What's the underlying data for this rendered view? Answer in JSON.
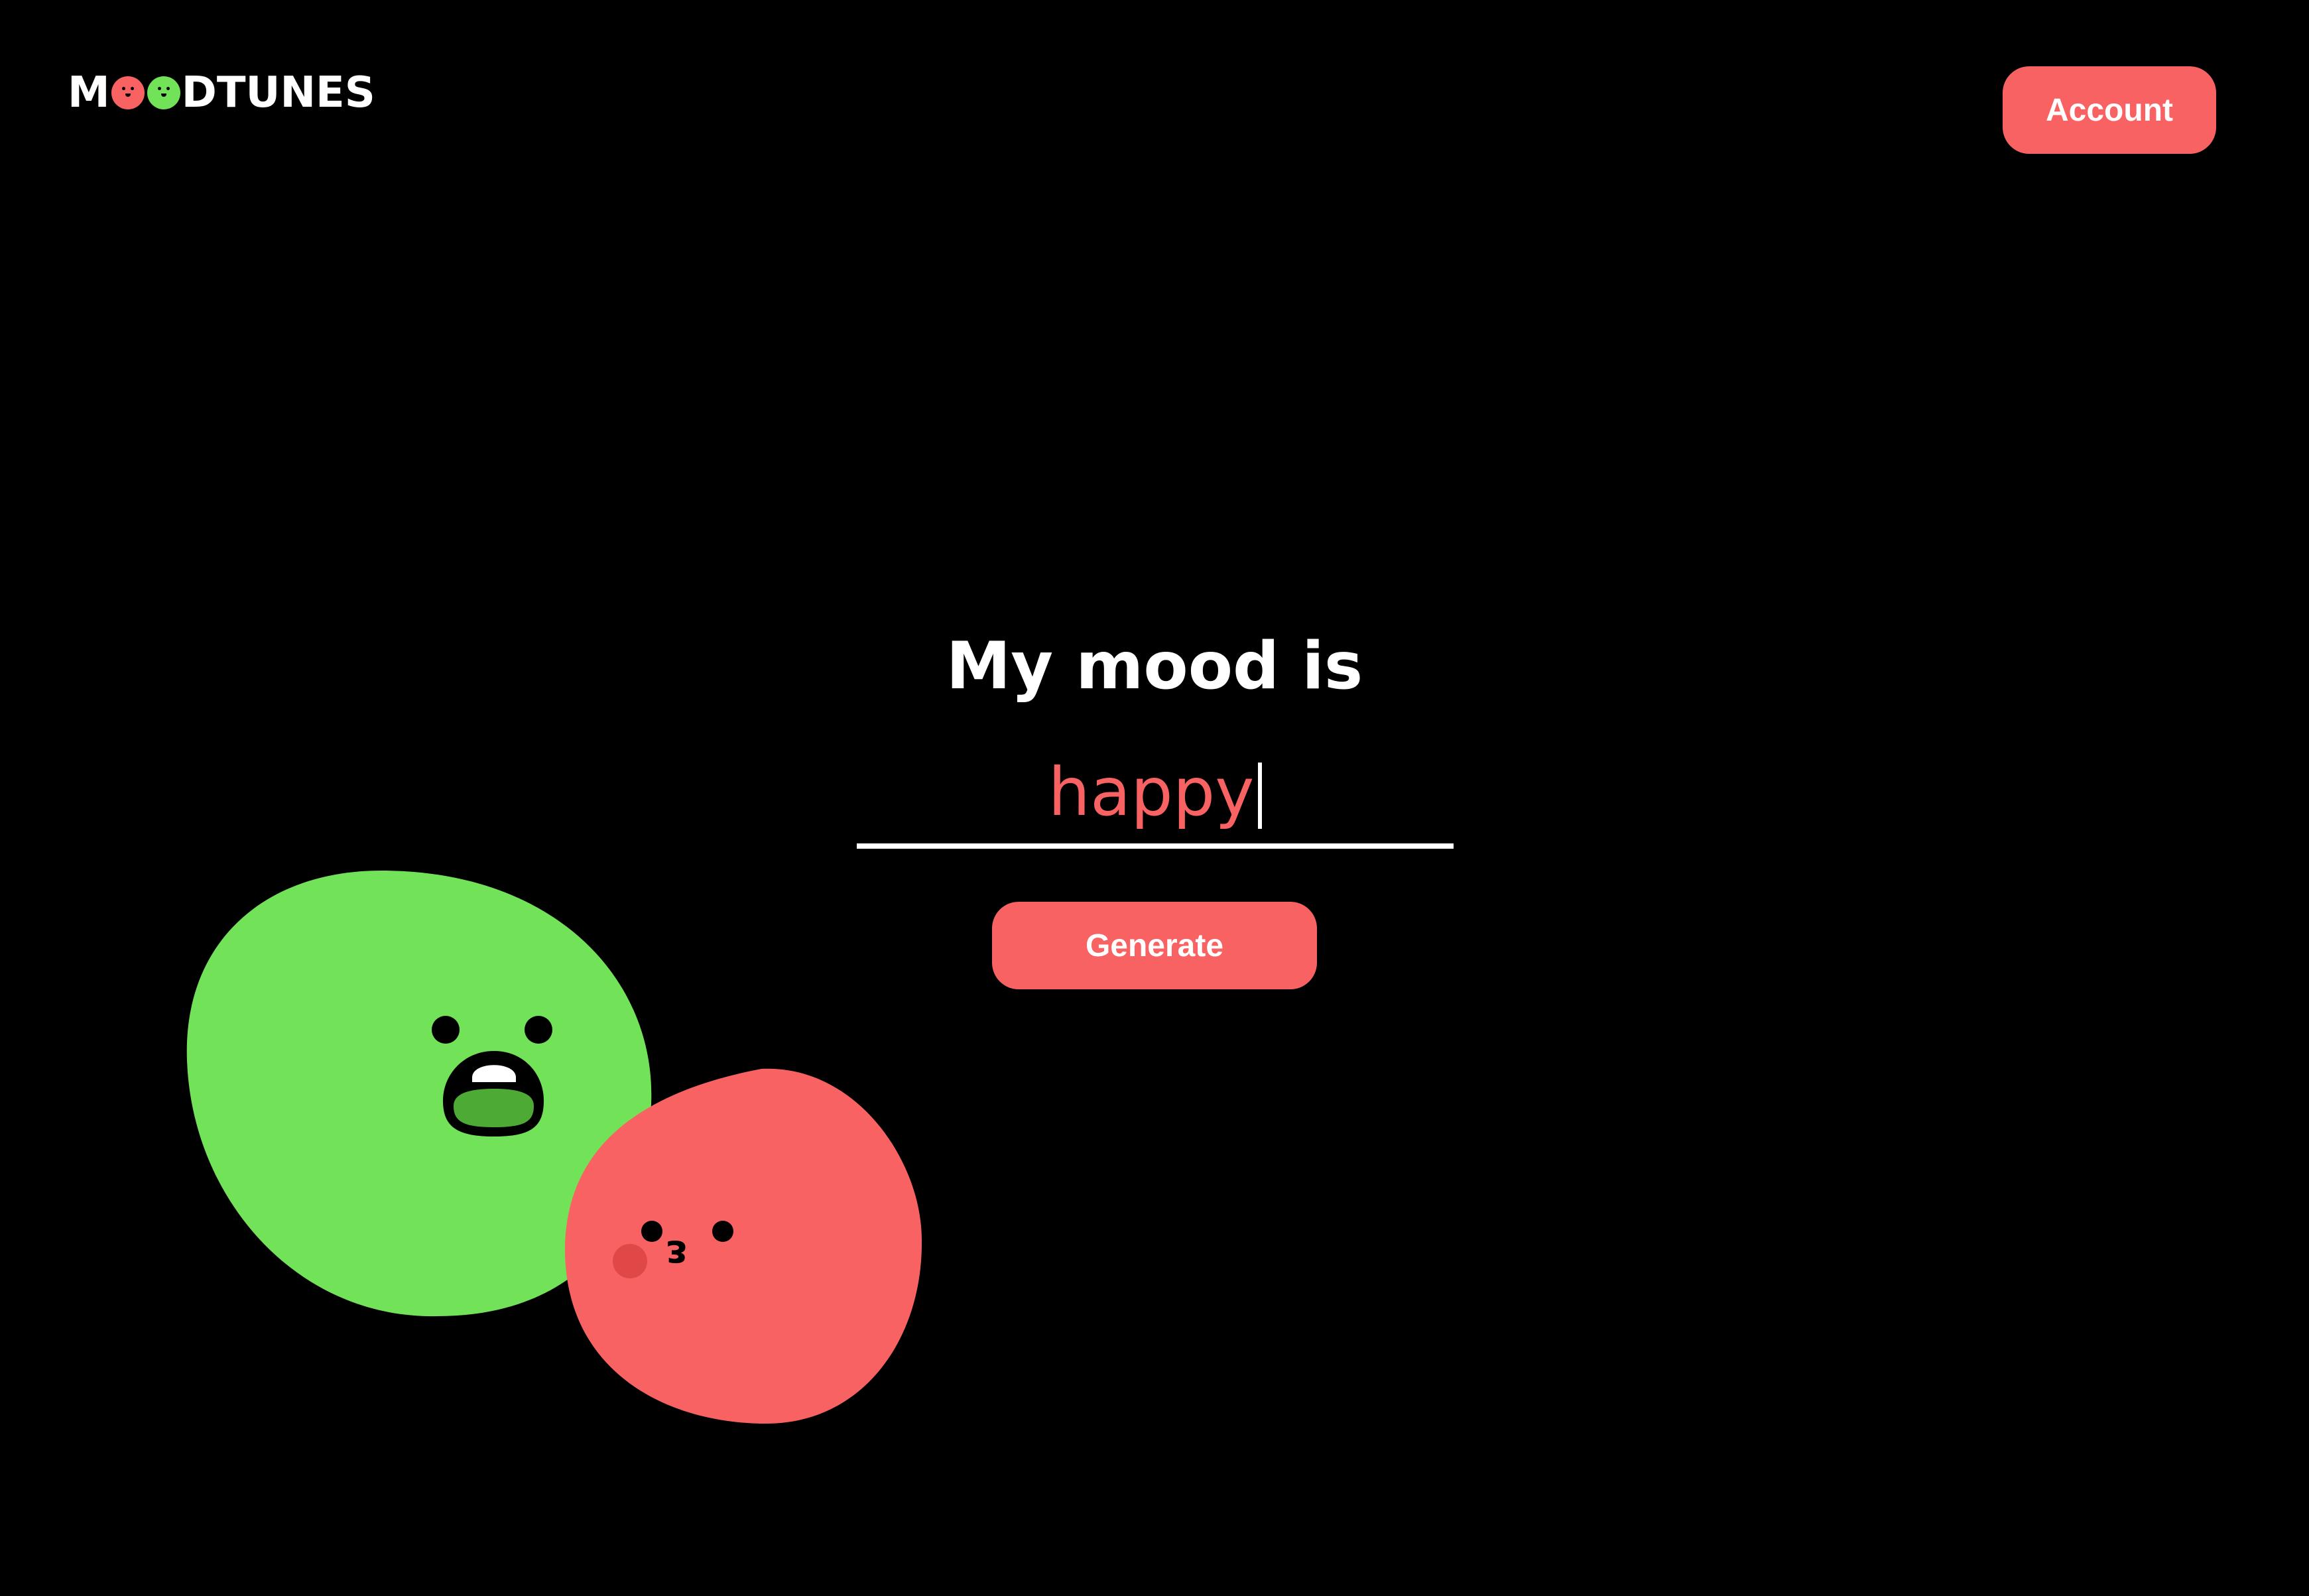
{
  "header": {
    "logo_prefix": "M",
    "logo_suffix": "DTUNES",
    "account_label": "Account"
  },
  "main": {
    "title": "My mood is",
    "mood_value": "happy",
    "generate_label": "Generate"
  },
  "colors": {
    "background": "#000000",
    "accent_red": "#F96262",
    "blob_green": "#72E258",
    "text": "#FFFFFF"
  },
  "icons": {
    "logo_blob_red": "red-blob-face-icon",
    "logo_blob_green": "green-blob-face-icon",
    "mascot_green": "green-blob-mascot",
    "mascot_red": "red-blob-mascot"
  }
}
